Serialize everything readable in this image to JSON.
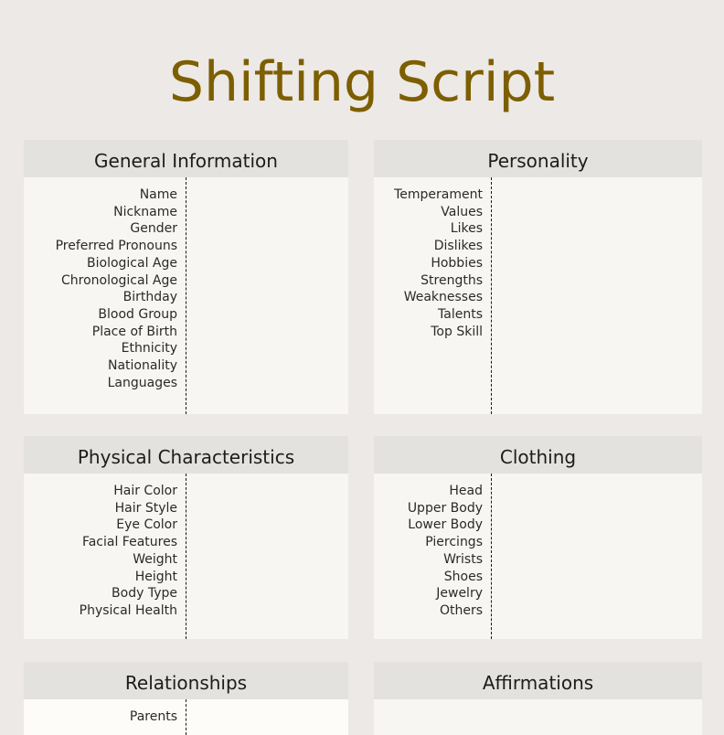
{
  "title": "Shifting Script",
  "colors": {
    "title": "#7d5e00",
    "background": "#ece9e6",
    "header": "#e3e2df",
    "card": "#f8f6f2"
  },
  "sections": {
    "general": {
      "title": "General Information",
      "fields": [
        "Name",
        "Nickname",
        "Gender",
        "Preferred Pronouns",
        "Biological Age",
        "Chronological Age",
        "Birthday",
        "Blood Group",
        "Place of Birth",
        "Ethnicity",
        "Nationality",
        "Languages"
      ]
    },
    "personality": {
      "title": "Personality",
      "fields": [
        "Temperament",
        "Values",
        "Likes",
        "Dislikes",
        "Hobbies",
        "Strengths",
        "Weaknesses",
        "Talents",
        "Top Skill"
      ]
    },
    "physical": {
      "title": "Physical Characteristics",
      "fields": [
        "Hair Color",
        "Hair Style",
        "Eye Color",
        "Facial Features",
        "Weight",
        "Height",
        "Body Type",
        "Physical Health"
      ]
    },
    "clothing": {
      "title": "Clothing",
      "fields": [
        "Head",
        "Upper Body",
        "Lower Body",
        "Piercings",
        "Wrists",
        "Shoes",
        "Jewelry",
        "Others"
      ]
    },
    "relationships": {
      "title": "Relationships",
      "fields": [
        "Parents"
      ]
    },
    "affirmations": {
      "title": "Affirmations",
      "fields": []
    }
  }
}
